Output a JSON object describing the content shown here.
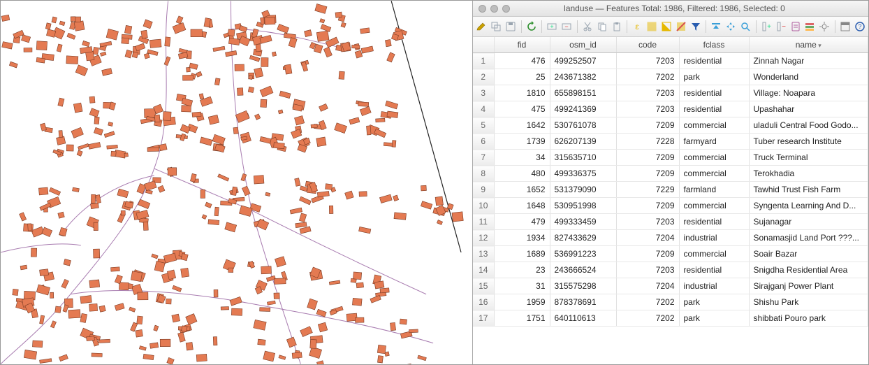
{
  "window": {
    "layer_name": "landuse",
    "features_total": 1986,
    "features_filtered": 1986,
    "features_selected": 0,
    "title_template": "landuse — Features Total: 1986, Filtered: 1986, Selected: 0"
  },
  "toolbar": [
    {
      "name": "toggle-editing-icon",
      "glyph": "pencil",
      "color": "#caa000"
    },
    {
      "name": "multi-edit-icon",
      "glyph": "multiedit",
      "color": "#9aa5b0"
    },
    {
      "name": "save-edits-icon",
      "glyph": "save",
      "color": "#9aa5b0"
    },
    {
      "sep": true
    },
    {
      "name": "reload-icon",
      "glyph": "reload",
      "color": "#2d8f2d"
    },
    {
      "sep": true
    },
    {
      "name": "add-feature-icon",
      "glyph": "addrow",
      "color": "#9aa5b0"
    },
    {
      "name": "delete-feature-icon",
      "glyph": "delrow",
      "color": "#9aa5b0"
    },
    {
      "sep": true
    },
    {
      "name": "cut-icon",
      "glyph": "cut",
      "color": "#9aa5b0"
    },
    {
      "name": "copy-icon",
      "glyph": "copy",
      "color": "#9aa5b0"
    },
    {
      "name": "paste-icon",
      "glyph": "paste",
      "color": "#9aa5b0"
    },
    {
      "sep": true
    },
    {
      "name": "select-by-expression-icon",
      "glyph": "expr",
      "color": "#e6b800"
    },
    {
      "name": "select-all-icon",
      "glyph": "selall",
      "color": "#e6b800"
    },
    {
      "name": "invert-selection-icon",
      "glyph": "invert",
      "color": "#e6b800"
    },
    {
      "name": "deselect-all-icon",
      "glyph": "desel",
      "color": "#d9534f"
    },
    {
      "name": "filter-selection-icon",
      "glyph": "funnel",
      "color": "#2a5db0"
    },
    {
      "sep": true
    },
    {
      "name": "move-selection-top-icon",
      "glyph": "movetop",
      "color": "#3a9fd8"
    },
    {
      "name": "pan-to-selected-icon",
      "glyph": "pan",
      "color": "#3a9fd8"
    },
    {
      "name": "zoom-to-selected-icon",
      "glyph": "zoom",
      "color": "#3a9fd8"
    },
    {
      "sep": true
    },
    {
      "name": "new-field-icon",
      "glyph": "newcol",
      "color": "#9aa5b0"
    },
    {
      "name": "delete-field-icon",
      "glyph": "delcol",
      "color": "#9aa5b0"
    },
    {
      "name": "open-field-calc-icon",
      "glyph": "calc",
      "color": "#b05fa0"
    },
    {
      "name": "conditional-format-icon",
      "glyph": "condfmt",
      "color": "#c05050"
    },
    {
      "name": "actions-icon",
      "glyph": "gear",
      "color": "#888"
    },
    {
      "sep": true
    },
    {
      "name": "dock-icon",
      "glyph": "dock",
      "color": "#888"
    },
    {
      "name": "help-icon",
      "glyph": "help",
      "color": "#2a5db0"
    }
  ],
  "columns": [
    {
      "key": "fid",
      "label": "fid",
      "align": "num"
    },
    {
      "key": "osm_id",
      "label": "osm_id",
      "align": "txt"
    },
    {
      "key": "code",
      "label": "code",
      "align": "num"
    },
    {
      "key": "fclass",
      "label": "fclass",
      "align": "txt"
    },
    {
      "key": "name",
      "label": "name",
      "align": "txt",
      "sorted": true
    }
  ],
  "rows": [
    {
      "n": 1,
      "fid": 476,
      "osm_id": "499252507",
      "code": 7203,
      "fclass": "residential",
      "name": "Zinnah Nagar"
    },
    {
      "n": 2,
      "fid": 25,
      "osm_id": "243671382",
      "code": 7202,
      "fclass": "park",
      "name": "Wonderland"
    },
    {
      "n": 3,
      "fid": 1810,
      "osm_id": "655898151",
      "code": 7203,
      "fclass": "residential",
      "name": "Village: Noapara"
    },
    {
      "n": 4,
      "fid": 475,
      "osm_id": "499241369",
      "code": 7203,
      "fclass": "residential",
      "name": "Upashahar"
    },
    {
      "n": 5,
      "fid": 1642,
      "osm_id": "530761078",
      "code": 7209,
      "fclass": "commercial",
      "name": "uladuli Central Food Godo..."
    },
    {
      "n": 6,
      "fid": 1739,
      "osm_id": "626207139",
      "code": 7228,
      "fclass": "farmyard",
      "name": "Tuber research Institute"
    },
    {
      "n": 7,
      "fid": 34,
      "osm_id": "315635710",
      "code": 7209,
      "fclass": "commercial",
      "name": "Truck Terminal"
    },
    {
      "n": 8,
      "fid": 480,
      "osm_id": "499336375",
      "code": 7209,
      "fclass": "commercial",
      "name": "Terokhadia"
    },
    {
      "n": 9,
      "fid": 1652,
      "osm_id": "531379090",
      "code": 7229,
      "fclass": "farmland",
      "name": "Tawhid Trust Fish Farm"
    },
    {
      "n": 10,
      "fid": 1648,
      "osm_id": "530951998",
      "code": 7209,
      "fclass": "commercial",
      "name": "Syngenta Learning And D..."
    },
    {
      "n": 11,
      "fid": 479,
      "osm_id": "499333459",
      "code": 7203,
      "fclass": "residential",
      "name": "Sujanagar"
    },
    {
      "n": 12,
      "fid": 1934,
      "osm_id": "827433629",
      "code": 7204,
      "fclass": "industrial",
      "name": "Sonamasjid Land Port ???..."
    },
    {
      "n": 13,
      "fid": 1689,
      "osm_id": "536991223",
      "code": 7209,
      "fclass": "commercial",
      "name": "Soair Bazar"
    },
    {
      "n": 14,
      "fid": 23,
      "osm_id": "243666524",
      "code": 7203,
      "fclass": "residential",
      "name": "Snigdha Residential Area"
    },
    {
      "n": 15,
      "fid": 31,
      "osm_id": "315575298",
      "code": 7204,
      "fclass": "industrial",
      "name": "Sirajganj Power Plant"
    },
    {
      "n": 16,
      "fid": 1959,
      "osm_id": "878378691",
      "code": 7202,
      "fclass": "park",
      "name": "Shishu Park"
    },
    {
      "n": 17,
      "fid": 1751,
      "osm_id": "640110613",
      "code": 7202,
      "fclass": "park",
      "name": "shibbati Pouro park"
    }
  ],
  "map": {
    "building_fill": "#e47a52",
    "building_stroke": "#7a3b24",
    "road_stroke": "#a87cb0",
    "edge_stroke": "#222"
  }
}
